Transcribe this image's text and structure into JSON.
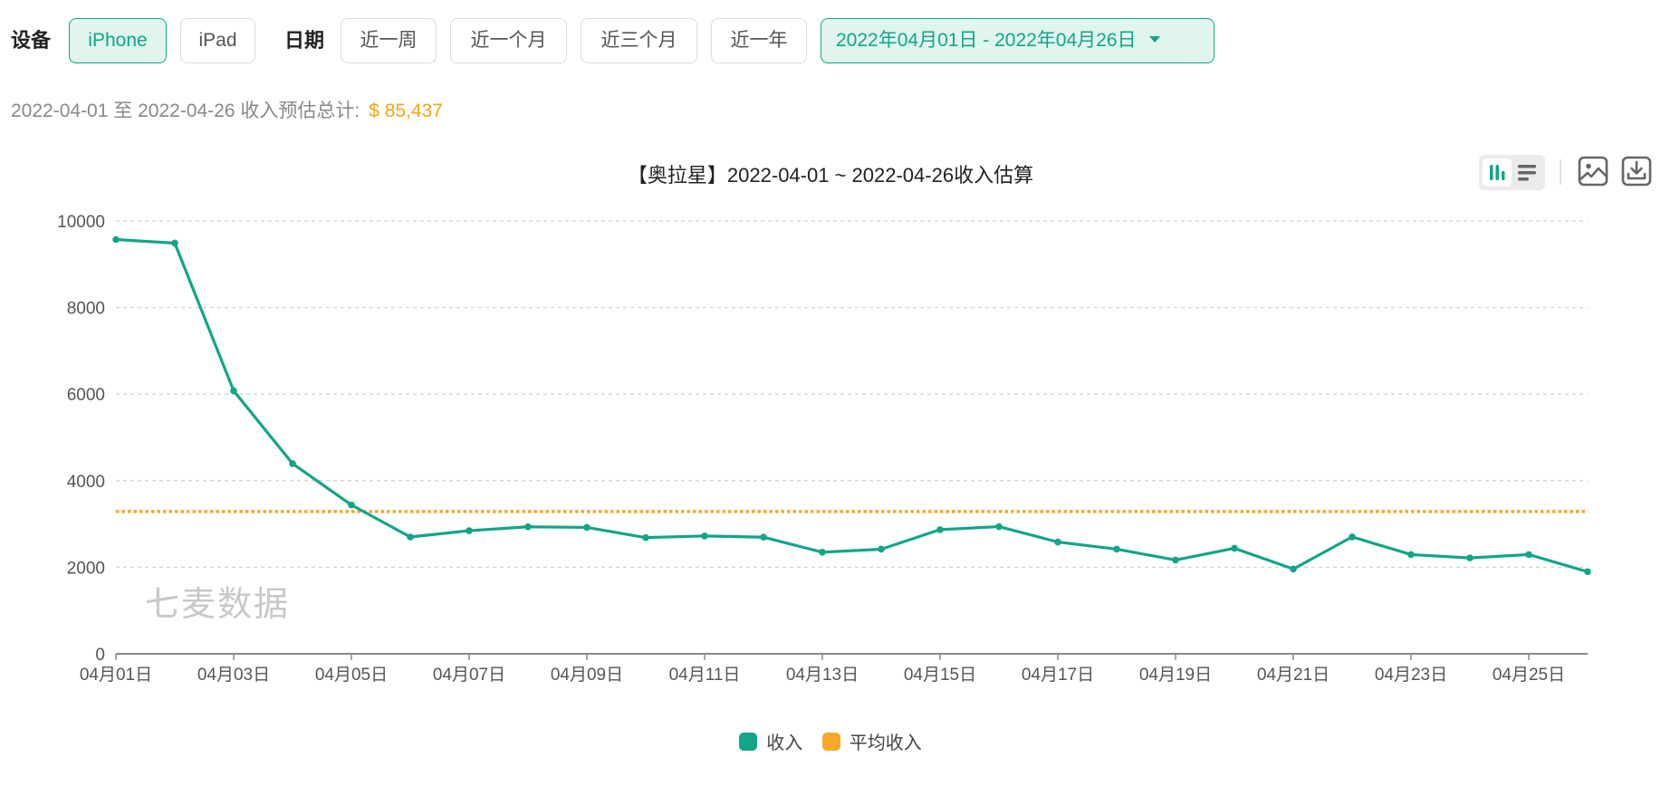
{
  "filters": {
    "device_label": "设备",
    "devices": [
      {
        "label": "iPhone",
        "active": true
      },
      {
        "label": "iPad",
        "active": false
      }
    ],
    "date_label": "日期",
    "date_presets": [
      {
        "label": "近一周"
      },
      {
        "label": "近一个月"
      },
      {
        "label": "近三个月"
      },
      {
        "label": "近一年"
      }
    ],
    "date_range": "2022年04月01日 - 2022年04月26日"
  },
  "summary": {
    "text": "2022-04-01 至 2022-04-26 收入预估总计:",
    "total": "$ 85,437"
  },
  "toolbar": {
    "chart_type_options": [
      "bar-chart-icon",
      "horizontal-bar-icon"
    ],
    "active_chart_type": "bar-chart-icon",
    "actions": [
      "image-icon",
      "download-icon"
    ]
  },
  "watermark": "七麦数据",
  "colors": {
    "accent": "#12a587",
    "income_series": "#12a587",
    "average_series": "#f7a82a",
    "total_text": "#f2a516"
  },
  "chart_data": {
    "type": "line",
    "title": "【奥拉星】2022-04-01 ~ 2022-04-26收入估算",
    "xlabel": "",
    "ylabel": "",
    "ylim": [
      0,
      10000
    ],
    "y_ticks": [
      0,
      2000,
      4000,
      6000,
      8000,
      10000
    ],
    "grid": true,
    "legend_position": "bottom",
    "x": [
      "04月01日",
      "04月02日",
      "04月03日",
      "04月04日",
      "04月05日",
      "04月06日",
      "04月07日",
      "04月08日",
      "04月09日",
      "04月10日",
      "04月11日",
      "04月12日",
      "04月13日",
      "04月14日",
      "04月15日",
      "04月16日",
      "04月17日",
      "04月18日",
      "04月19日",
      "04月20日",
      "04月21日",
      "04月22日",
      "04月23日",
      "04月24日",
      "04月25日",
      "04月26日"
    ],
    "x_tick_labels": [
      "04月01日",
      "04月03日",
      "04月05日",
      "04月07日",
      "04月09日",
      "04月11日",
      "04月13日",
      "04月15日",
      "04月17日",
      "04月19日",
      "04月21日",
      "04月23日",
      "04月25日"
    ],
    "series": [
      {
        "name": "收入",
        "style": "solid-with-markers",
        "values": [
          9571,
          9488,
          6076,
          4394,
          3439,
          2699,
          2844,
          2934,
          2920,
          2685,
          2722,
          2694,
          2347,
          2417,
          2868,
          2938,
          2583,
          2417,
          2167,
          2438,
          1958,
          2701,
          2292,
          2215,
          2292,
          1896
        ]
      },
      {
        "name": "平均收入",
        "style": "dotted",
        "constant": 3286
      }
    ]
  }
}
